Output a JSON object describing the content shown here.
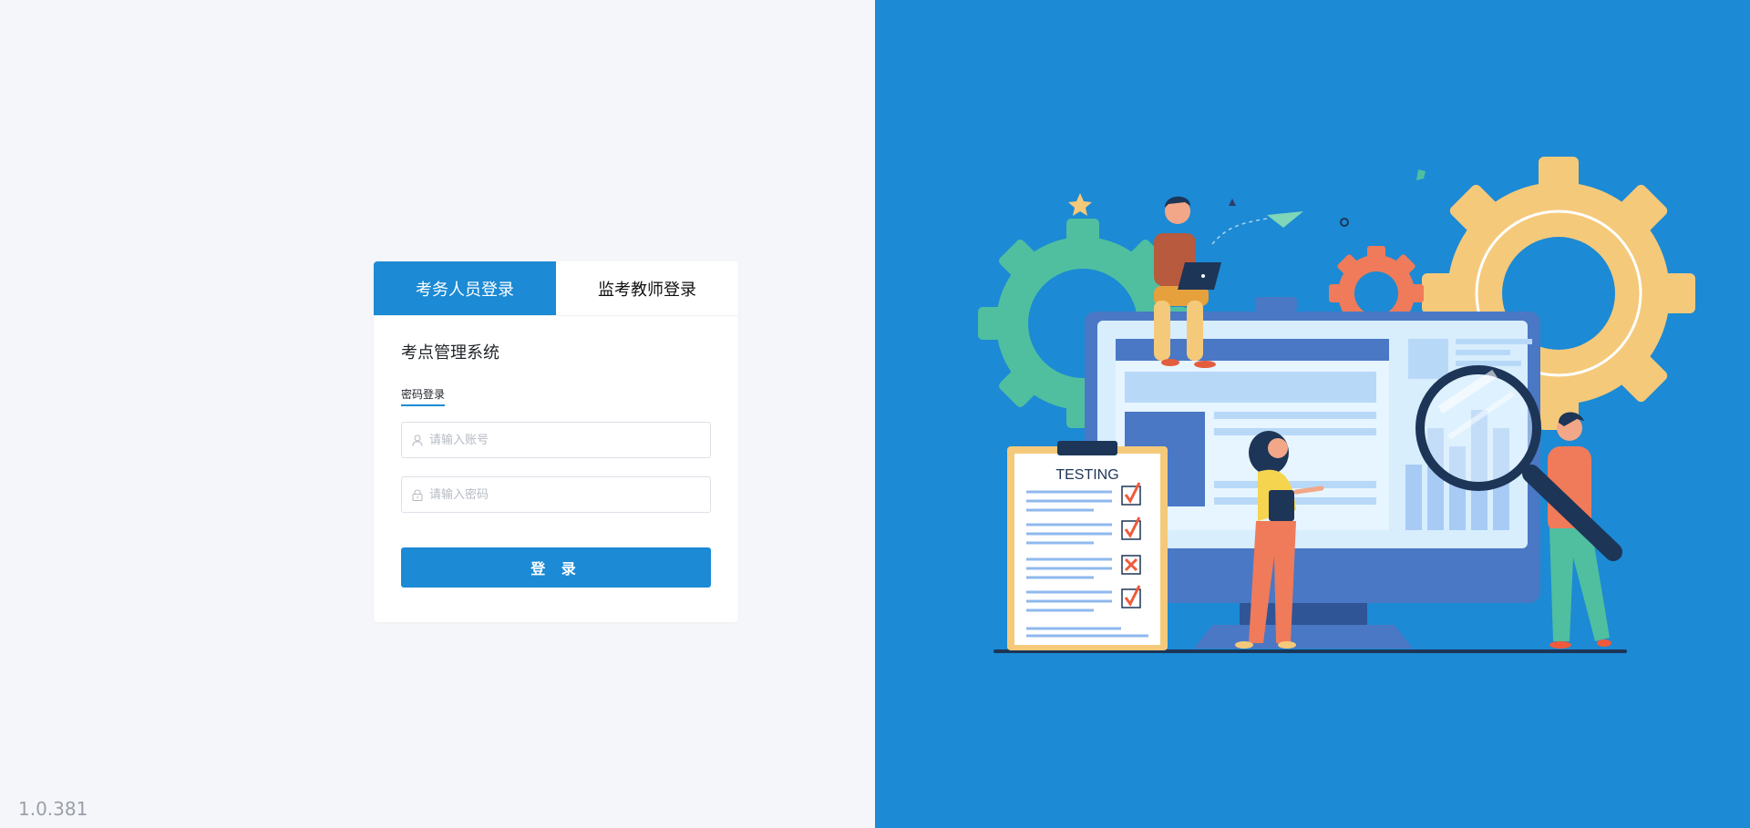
{
  "tabs": [
    {
      "label": "考务人员登录",
      "active": true
    },
    {
      "label": "监考教师登录",
      "active": false
    }
  ],
  "system_title": "考点管理系统",
  "login_method": "密码登录",
  "account": {
    "placeholder": "请输入账号",
    "value": ""
  },
  "password": {
    "placeholder": "请输入密码",
    "value": ""
  },
  "login_button": "登 录",
  "version": "1.0.381",
  "illustration": {
    "clipboard_title": "TESTING",
    "icons": [
      "user-icon",
      "lock-icon"
    ],
    "colors": {
      "brand": "#1c8ad4",
      "gear_yellow": "#f5c97a",
      "gear_green": "#4fbfa0",
      "gear_orange": "#ef7b5a"
    }
  }
}
